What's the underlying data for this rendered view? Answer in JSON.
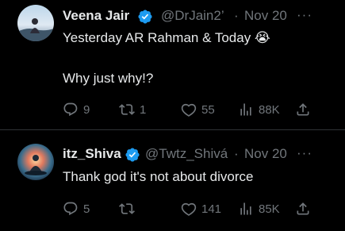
{
  "tweets": [
    {
      "display_name": "Veena Jair",
      "handle": "@DrJain2’",
      "separator": "·",
      "date": "Nov 20",
      "more_label": "···",
      "text_line1": "Yesterday AR Rahman & Today 😭",
      "text_line2": "Why just why!?",
      "replies": "9",
      "reposts": "1",
      "likes": "55",
      "views": "88K"
    },
    {
      "display_name": "itz_Shiva",
      "handle": "@Twtz_Shivá",
      "separator": "·",
      "date": "Nov 20",
      "more_label": "···",
      "text_line1": "Thank god it's not about divorce",
      "replies": "5",
      "reposts": "",
      "likes": "141",
      "views": "85K"
    }
  ],
  "colors": {
    "background": "#000000",
    "text_primary": "#e7e9ea",
    "text_secondary": "#71767b",
    "verified_blue": "#1d9bf0",
    "divider": "#2f3336"
  },
  "icons": [
    "reply-icon",
    "repost-icon",
    "like-icon",
    "views-icon",
    "share-icon",
    "verified-badge-icon",
    "more-icon"
  ]
}
